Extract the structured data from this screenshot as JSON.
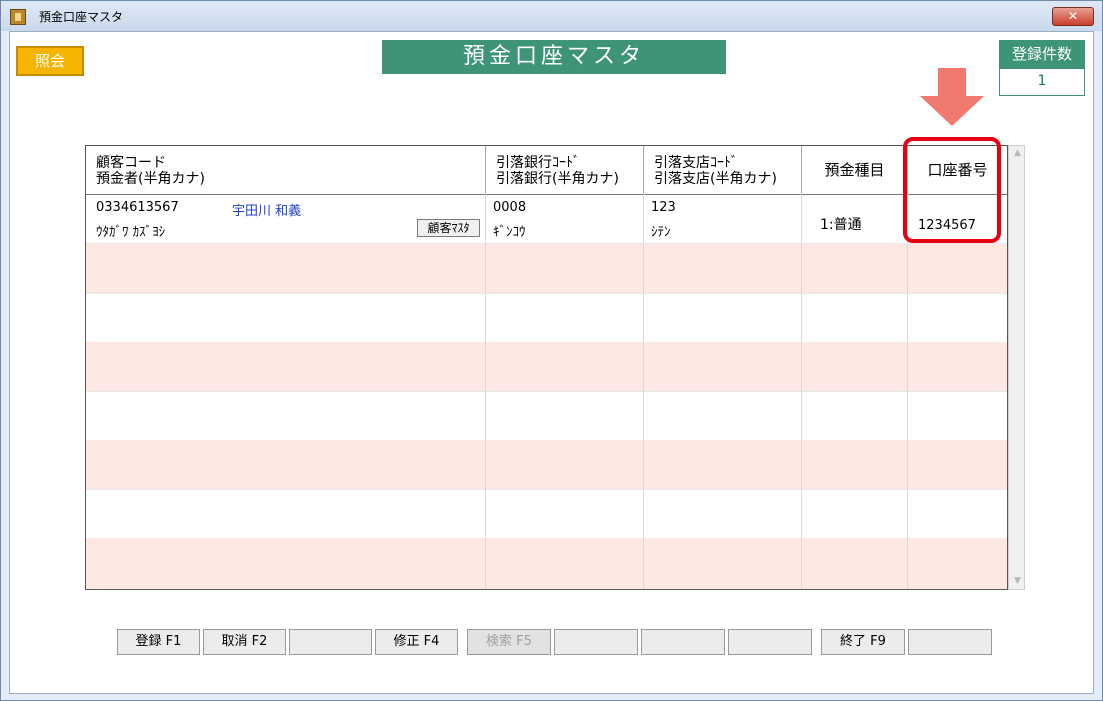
{
  "window": {
    "title": "預金口座マスタ",
    "close_label": "✕"
  },
  "toolbar": {
    "inquiry_label": "照会"
  },
  "header": {
    "page_title": "預金口座マスタ",
    "count_label": "登録件数",
    "count_value": "1"
  },
  "grid": {
    "columns": {
      "customer_l1": "顧客コード",
      "customer_l2": "預金者(半角カナ)",
      "bank_l1": "引落銀行ｺｰﾄﾞ",
      "bank_l2": "引落銀行(半角カナ)",
      "branch_l1": "引落支店ｺｰﾄﾞ",
      "branch_l2": "引落支店(半角カナ)",
      "deposit_type": "預金種目",
      "account_number": "口座番号"
    },
    "rows": [
      {
        "customer_code": "0334613567",
        "customer_name": "宇田川 和義",
        "customer_kana": "ｳﾀｶﾞﾜ ｶｽﾞﾖｼ",
        "customer_master_button": "顧客ﾏｽﾀ",
        "bank_code": "0008",
        "bank_kana": "ｷﾞﾝｺｳ",
        "branch_code": "123",
        "branch_kana": "ｼﾃﾝ",
        "deposit_type": "1:普通",
        "account_number": "1234567"
      }
    ]
  },
  "function_keys": [
    "登録 F1",
    "取消 F2",
    "",
    "修正 F4",
    "検索 F5",
    "",
    "",
    "",
    "終了 F9",
    ""
  ],
  "colors": {
    "accent": "#3e9479",
    "inquiry": "#f4b400",
    "highlight": "#e60012",
    "arrow": "#f07a6e",
    "row_alt": "#fde8e3"
  }
}
